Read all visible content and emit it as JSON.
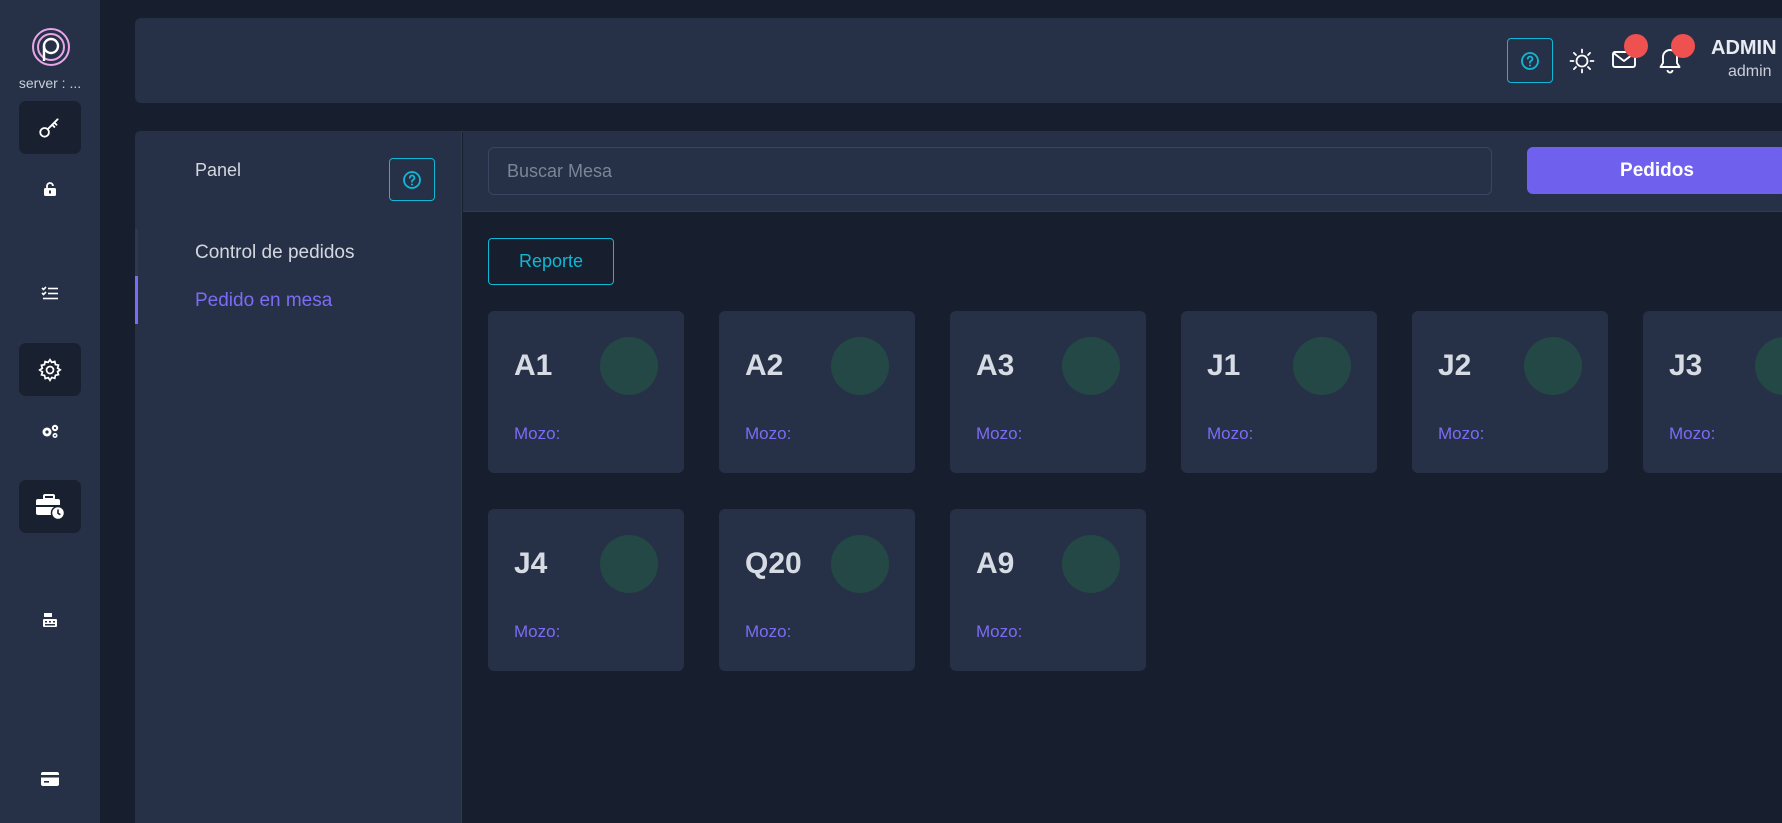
{
  "app": {
    "server_label": "server : ..."
  },
  "header": {
    "user_name": "ADMIN",
    "user_role": "admin",
    "colors": {
      "accent": "#0fb9d6",
      "badge": "#ef5050"
    }
  },
  "sidebar": {
    "title": "Panel",
    "items": [
      {
        "label": "Control de pedidos",
        "active": false
      },
      {
        "label": "Pedido en mesa",
        "active": true
      }
    ]
  },
  "toolbar": {
    "search_placeholder": "Buscar Mesa",
    "orders_label": "Pedidos",
    "report_label": "Reporte"
  },
  "tables": [
    {
      "name": "A1",
      "waiter_label": "Mozo:"
    },
    {
      "name": "A2",
      "waiter_label": "Mozo:"
    },
    {
      "name": "A3",
      "waiter_label": "Mozo:"
    },
    {
      "name": "J1",
      "waiter_label": "Mozo:"
    },
    {
      "name": "J2",
      "waiter_label": "Mozo:"
    },
    {
      "name": "J3",
      "waiter_label": "Mozo:"
    },
    {
      "name": "J4",
      "waiter_label": "Mozo:"
    },
    {
      "name": "Q20",
      "waiter_label": "Mozo:"
    },
    {
      "name": "A9",
      "waiter_label": "Mozo:"
    }
  ],
  "icons": {
    "rail": [
      "key-icon",
      "unlock-icon",
      "checklist-icon",
      "gear-icon",
      "gears-icon",
      "briefcase-clock-icon",
      "cash-register-icon",
      "credit-card-icon"
    ],
    "header": [
      "help-icon",
      "sun-icon",
      "mail-icon",
      "bell-icon"
    ]
  }
}
